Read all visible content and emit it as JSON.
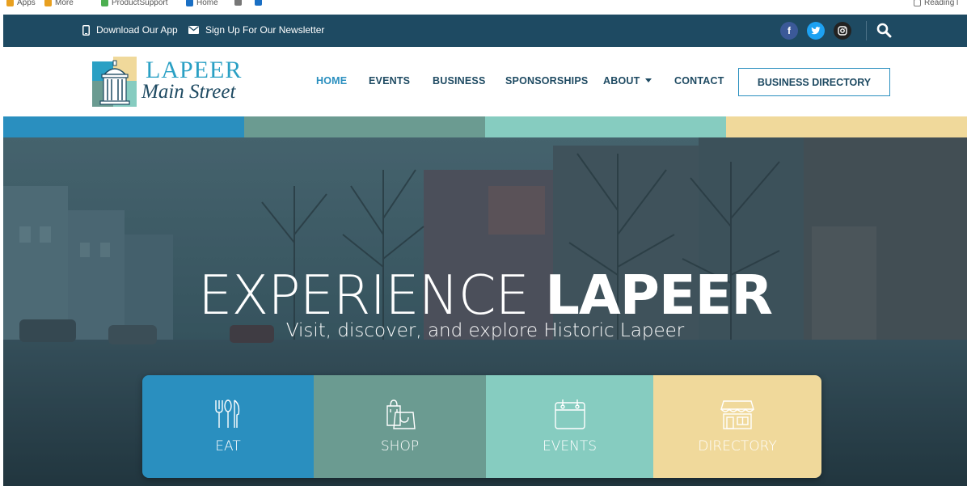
{
  "bookmarks": {
    "items": [
      {
        "label": "Apps",
        "color": "#e8a020"
      },
      {
        "label": "More",
        "color": "#e8a020"
      },
      {
        "label": "ProductSupport",
        "color": "#4caf50"
      },
      {
        "label": "Home",
        "color": "#1a6fc4"
      },
      {
        "label": "",
        "color": "#777777"
      },
      {
        "label": "",
        "color": "#1a6fc4"
      }
    ],
    "reading_list": "Reading l"
  },
  "topbar": {
    "download_app": "Download Our App",
    "newsletter": "Sign Up For Our Newsletter",
    "social": [
      "facebook",
      "twitter",
      "instagram"
    ],
    "search_icon": "search-icon"
  },
  "logo": {
    "line1": "LAPEER",
    "line2": "Main Street"
  },
  "nav": {
    "home": "HOME",
    "events": "EVENTS",
    "business": "BUSINESS",
    "sponsorships": "SPONSORSHIPS",
    "about": "ABOUT",
    "contact": "CONTACT",
    "directory_button": "BUSINESS DIRECTORY"
  },
  "stripe_colors": [
    "#2a8fbf",
    "#6b9b91",
    "#86ccc0",
    "#f0d99b"
  ],
  "hero": {
    "title_light": "EXPERIENCE",
    "title_bold": "LAPEER",
    "subtitle": "Visit, discover, and explore Historic Lapeer"
  },
  "tiles": [
    {
      "label": "EAT",
      "icon": "utensils-icon",
      "color": "#2a8fbf"
    },
    {
      "label": "SHOP",
      "icon": "shopping-bags-icon",
      "color": "#6b9b91"
    },
    {
      "label": "EVENTS",
      "icon": "calendar-icon",
      "color": "#86ccc0"
    },
    {
      "label": "DIRECTORY",
      "icon": "storefront-icon",
      "color": "#f0d99b"
    }
  ],
  "colors": {
    "navy": "#1e4a62",
    "accent": "#2a8fbf",
    "facebook": "#3b5998",
    "twitter": "#1da1f2",
    "instagram": "#222222"
  }
}
